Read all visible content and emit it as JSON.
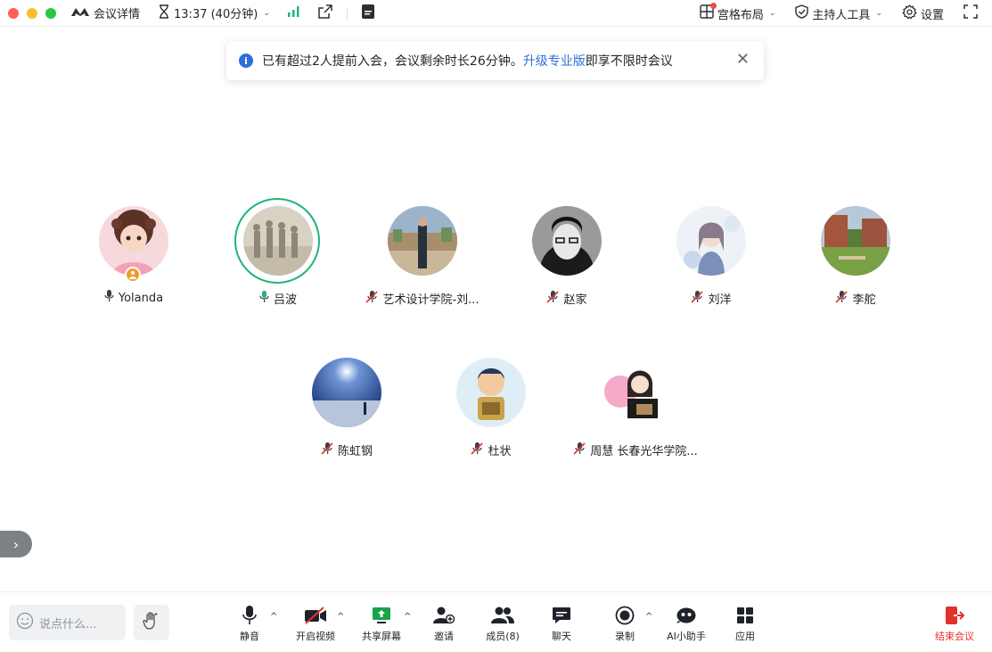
{
  "titlebar": {
    "meeting_info": "会议详情",
    "timer": "13:37 (40分钟)",
    "layout": "宫格布局",
    "host_tools": "主持人工具",
    "settings": "设置"
  },
  "notice": {
    "text_before": "已有超过2人提前入会，会议剩余时长26分钟。",
    "link": "升级专业版",
    "text_after": "即享不限时会议"
  },
  "participants": [
    {
      "name": "Yolanda",
      "mic": "on"
    },
    {
      "name": "吕波",
      "mic": "on"
    },
    {
      "name": "艺术设计学院-刘...",
      "mic": "muted"
    },
    {
      "name": "赵家",
      "mic": "muted"
    },
    {
      "name": "刘洋",
      "mic": "muted"
    },
    {
      "name": "李舵",
      "mic": "muted"
    },
    {
      "name": "陈虹钢",
      "mic": "muted"
    },
    {
      "name": "杜状",
      "mic": "muted"
    },
    {
      "name": "周慧 长春光华学院...",
      "mic": "muted"
    }
  ],
  "bottombar": {
    "chat_placeholder": "说点什么...",
    "mute": "静音",
    "video": "开启视频",
    "share": "共享屏幕",
    "invite": "邀请",
    "members": "成员(8)",
    "chat": "聊天",
    "record": "录制",
    "ai": "AI小助手",
    "apps": "应用",
    "end": "结束会议"
  },
  "colors": {
    "accent": "#2f6fd8",
    "speaking": "#1fb47a",
    "signal": "#1fb47a",
    "danger": "#e2332a",
    "share_green": "#17a34a"
  }
}
